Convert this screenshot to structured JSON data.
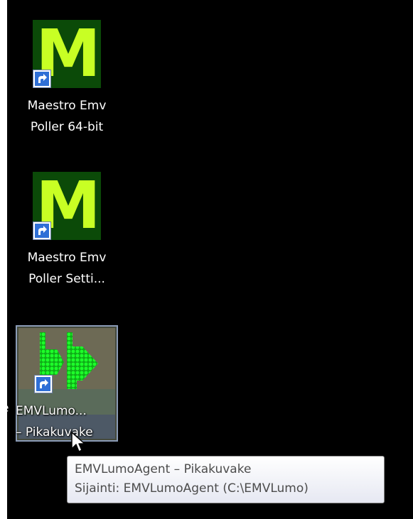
{
  "desktop": {
    "icons": [
      {
        "label_line1": "Maestro Emv",
        "label_line2": "Poller 64-bit",
        "glyph": "M",
        "icon": "maestro-m-icon"
      },
      {
        "label_line1": "Maestro Emv",
        "label_line2": "Poller Setti...",
        "glyph": "M",
        "icon": "maestro-m-icon"
      },
      {
        "label_line1": "EMVLumo...",
        "label_line2": "– Pikakuvake",
        "icon": "emvlumo-arrows-icon",
        "selected": true
      }
    ],
    "edge_text": "e"
  },
  "tooltip": {
    "line1": "EMVLumoAgent – Pikakuvake",
    "line2": "Sijainti: EMVLumoAgent (C:\\EMVLumo)"
  },
  "colors": {
    "desktop_bg": "#000000",
    "maestro_bg": "#0b4a08",
    "maestro_letter": "#c8ff24",
    "lumo_green": "#1dff2a",
    "selection_border": "#8a9bb6"
  }
}
